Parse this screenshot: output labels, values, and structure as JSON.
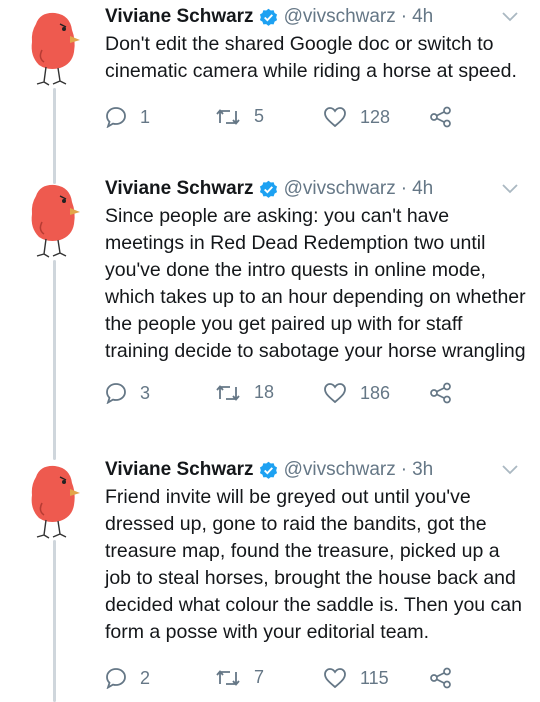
{
  "tweets": [
    {
      "name": "Viviane Schwarz",
      "handle": "@vivschwarz",
      "separator": "·",
      "time": "4h",
      "text": "Don't edit the shared Google doc or switch to cinematic camera while riding a horse at speed.",
      "replies": "1",
      "retweets": "5",
      "likes": "128"
    },
    {
      "name": "Viviane Schwarz",
      "handle": "@vivschwarz",
      "separator": "·",
      "time": "4h",
      "text": "Since people are asking: you can't have meetings in Red Dead Redemption two until you've done the intro quests in online mode, which takes up to an hour depending on whether the people you get paired up with for staff training decide to sabotage your horse wrangling",
      "replies": "3",
      "retweets": "18",
      "likes": "186"
    },
    {
      "name": "Viviane Schwarz",
      "handle": "@vivschwarz",
      "separator": "·",
      "time": "3h",
      "text": "Friend invite will be greyed out until you've dressed up, gone to raid the bandits, got the treasure map, found the treasure, picked up a job to steal horses, brought the house back and decided what colour the saddle is. Then you can form a posse with your editorial team.",
      "replies": "2",
      "retweets": "7",
      "likes": "115"
    }
  ],
  "colors": {
    "accent_verified": "#1da1f2",
    "muted": "#657786",
    "avatar_bird": "#ee5a4f",
    "thread_line": "#cfd6dc"
  },
  "icons": [
    "verified-badge-icon",
    "chevron-down-icon",
    "reply-icon",
    "retweet-icon",
    "like-icon",
    "share-icon"
  ]
}
